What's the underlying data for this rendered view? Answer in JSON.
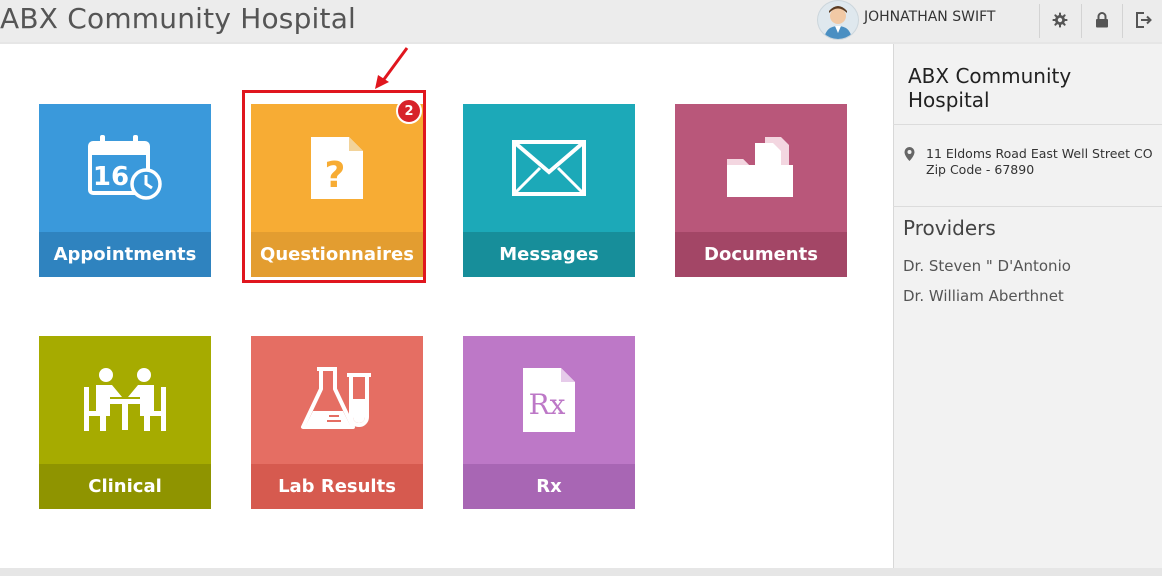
{
  "header": {
    "app_title": "ABX Community Hospital",
    "user_name": "JOHNATHAN SWIFT",
    "icons": [
      "gear-icon",
      "lock-icon",
      "logout-icon"
    ]
  },
  "tiles": [
    {
      "label": "Appointments",
      "icon": "calendar-clock-icon",
      "calendar_day": "16",
      "color": "#3a99db",
      "bar_color": "#2f83bf"
    },
    {
      "label": "Questionnaires",
      "icon": "question-document-icon",
      "color": "#f7ac34",
      "bar_color": "#e39d30",
      "badge": "2"
    },
    {
      "label": "Messages",
      "icon": "envelope-icon",
      "color": "#1ca9b8",
      "bar_color": "#178e9a"
    },
    {
      "label": "Documents",
      "icon": "folder-documents-icon",
      "color": "#b9577a",
      "bar_color": "#a34666"
    },
    {
      "label": "Clinical",
      "icon": "consultation-icon",
      "color": "#a6ab00",
      "bar_color": "#8f9400"
    },
    {
      "label": "Lab Results",
      "icon": "flask-icon",
      "color": "#e56e63",
      "bar_color": "#d65a4f"
    },
    {
      "label": "Rx",
      "icon": "prescription-icon",
      "rx_text": "Rx",
      "color": "#bd78c7",
      "bar_color": "#a866b4"
    }
  ],
  "sidebar": {
    "hospital_name": "ABX Community Hospital",
    "address_line1": "11 Eldoms Road East Well Street CO",
    "address_line2": "Zip Code - 67890",
    "providers_title": "Providers",
    "providers": [
      "Dr. Steven \" D'Antonio",
      "Dr. William Aberthnet"
    ]
  },
  "annotation": {
    "color": "#e0161e"
  }
}
